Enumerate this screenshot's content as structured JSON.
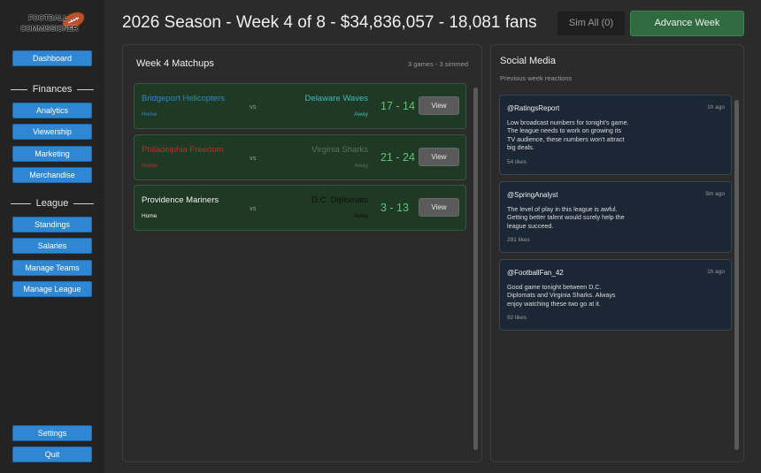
{
  "app": {
    "logo_line1": "FOOTBALL",
    "logo_line2": "COMMISSIONER"
  },
  "header": {
    "title": "2026 Season - Week 4 of 8 - $34,836,057 - 18,081 fans",
    "sim_all_label": "Sim All (0)",
    "advance_week_label": "Advance Week"
  },
  "sidebar": {
    "dashboard": "Dashboard",
    "finances_heading": "Finances",
    "finances_items": [
      "Analytics",
      "Viewership",
      "Marketing",
      "Merchandise"
    ],
    "league_heading": "League",
    "league_items": [
      "Standings",
      "Salaries",
      "Manage Teams",
      "Manage League"
    ],
    "settings": "Settings",
    "quit": "Quit"
  },
  "matchups": {
    "title": "Week 4 Matchups",
    "summary": "3 games - 3 simmed",
    "games": [
      {
        "home": "Bridgeport Helicopters",
        "away": "Delaware Waves",
        "vs": "vs",
        "home_label": "Home",
        "away_label": "Away",
        "score": "17 - 14",
        "view_label": "View",
        "home_color": "#2f86d3",
        "away_color": "#3fb8c2"
      },
      {
        "home": "Philadelphia Freedom",
        "away": "Virginia Sharks",
        "vs": "vs",
        "home_label": "Home",
        "away_label": "Away",
        "score": "21 - 24",
        "view_label": "View",
        "home_color": "#c42b2b",
        "away_color": "#5e6e65"
      },
      {
        "home": "Providence Mariners",
        "away": "D.C. Diplomats",
        "vs": "vs",
        "home_label": "Home",
        "away_label": "Away",
        "score": "3 - 13",
        "view_label": "View",
        "home_color": "#f0f0f0",
        "away_color": "#0d0d0d"
      }
    ]
  },
  "social": {
    "title": "Social Media",
    "subtitle": "Previous week reactions",
    "posts": [
      {
        "user": "@RatingsReport",
        "time": "1h ago",
        "text": "Low broadcast numbers for tonight's game. The league needs to work on growing its TV audience, these numbers won't attract big deals.",
        "likes": "54 likes"
      },
      {
        "user": "@SpringAnalyst",
        "time": "5m ago",
        "text": "The level of play in this league is awful. Getting better talent would surely help the league succeed.",
        "likes": "291 likes"
      },
      {
        "user": "@FootballFan_42",
        "time": "1h ago",
        "text": "Good game tonight between D.C. Diplomats and Virginia Sharks. Always enjoy watching these two go at it.",
        "likes": "92 likes"
      }
    ]
  },
  "colors": {
    "accent_blue": "#2f86d3",
    "advance_green": "#2f6b3f",
    "score_green": "#63c27a",
    "match_bg": "#1f3a24",
    "post_bg": "#1c2736"
  }
}
